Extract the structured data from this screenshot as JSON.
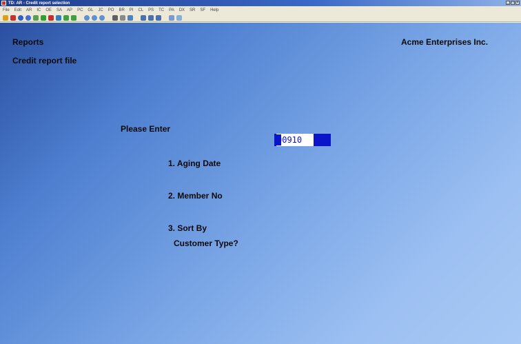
{
  "window": {
    "title": "TD: AR - Credit report selection"
  },
  "menu": [
    "File",
    "Edit",
    "AR",
    "IC",
    "OE",
    "SA",
    "AP",
    "PC",
    "GL",
    "JC",
    "PO",
    "BR",
    "PI",
    "CL",
    "PS",
    "TC",
    "PA",
    "DX",
    "SR",
    "SF",
    "Help"
  ],
  "toolbar": {
    "icons": [
      "open-icon",
      "print-icon",
      "help-icon",
      "settings-icon",
      "equals-icon",
      "check-icon",
      "cancel-icon",
      "refresh-icon",
      "up-icon",
      "down-icon",
      "circle-icon",
      "circle-icon",
      "circle-icon",
      "binoculars-icon",
      "zoom-icon",
      "reload-icon",
      "back-icon",
      "forward-icon",
      "stop-icon",
      "save-icon",
      "info-icon"
    ]
  },
  "screen": {
    "module": "Reports",
    "company": "Acme Enterprises Inc.",
    "subtitle": "Credit report file",
    "prompt": "Please Enter",
    "fields": [
      {
        "label": "1. Aging Date",
        "value": "90910"
      },
      {
        "label": "2. Member No"
      },
      {
        "label_line1": "3. Sort By",
        "label_line2": "Customer Type?"
      }
    ]
  }
}
